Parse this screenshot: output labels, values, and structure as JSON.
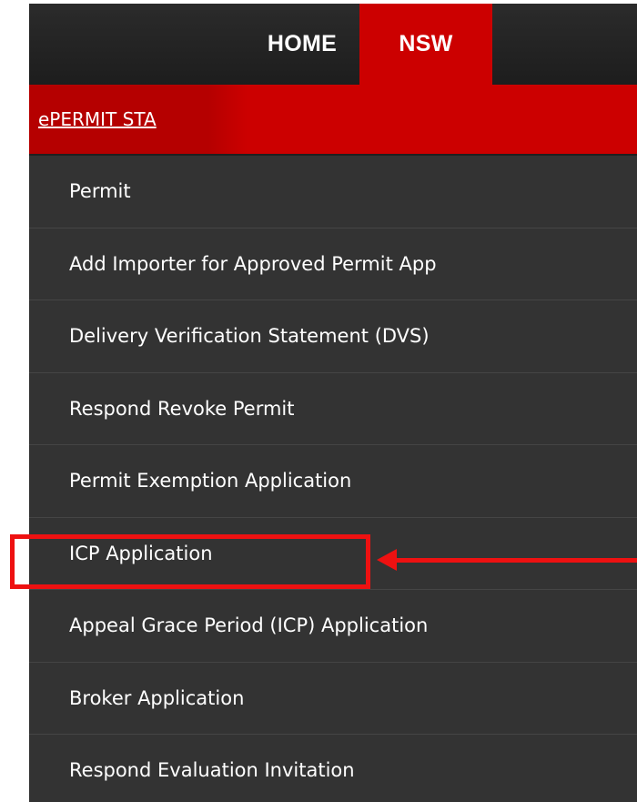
{
  "nav": {
    "tabs": [
      {
        "label": "HOME",
        "active": false
      },
      {
        "label": "NSW",
        "active": true
      }
    ]
  },
  "subnav": {
    "link": "ePERMIT STA"
  },
  "menu": {
    "items": [
      {
        "label": "Permit"
      },
      {
        "label": "Add Importer for Approved Permit App"
      },
      {
        "label": "Delivery Verification Statement (DVS)"
      },
      {
        "label": "Respond Revoke Permit"
      },
      {
        "label": "Permit Exemption Application"
      },
      {
        "label": "ICP Application",
        "highlighted": true
      },
      {
        "label": "Appeal Grace Period (ICP) Application"
      },
      {
        "label": "Broker Application"
      },
      {
        "label": "Respond Evaluation Invitation"
      }
    ]
  },
  "colors": {
    "accent": "#cc0000",
    "menu_bg": "#333333",
    "topbar_bg": "#242424",
    "annotation": "#ee1111"
  }
}
